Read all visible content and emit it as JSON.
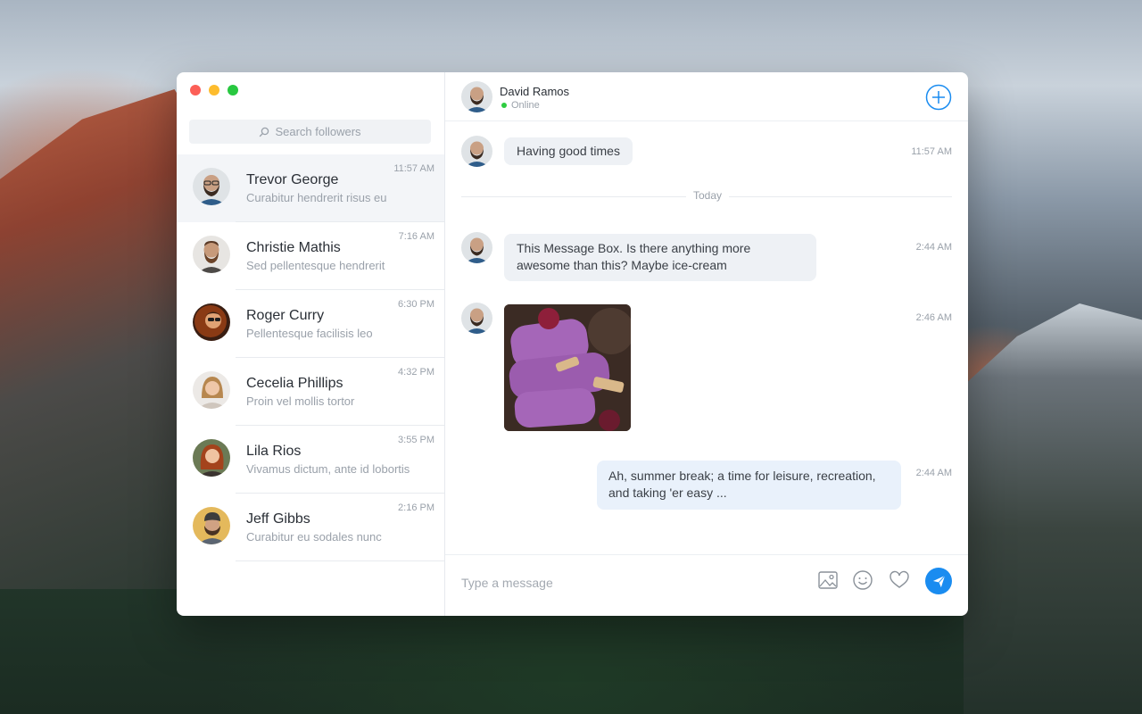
{
  "window": {
    "traffic_colors": [
      "#fc5f57",
      "#fdbc2e",
      "#28c840"
    ]
  },
  "sidebar": {
    "search_placeholder": "Search followers",
    "contacts": [
      {
        "name": "Trevor George",
        "preview": "Curabitur hendrerit risus eu",
        "time": "11:57 AM",
        "active": true
      },
      {
        "name": "Christie Mathis",
        "preview": "Sed pellentesque hendrerit",
        "time": "7:16 AM"
      },
      {
        "name": "Roger Curry",
        "preview": "Pellentesque facilisis leo",
        "time": "6:30 PM"
      },
      {
        "name": "Cecelia Phillips",
        "preview": "Proin vel mollis tortor",
        "time": "4:32 PM"
      },
      {
        "name": "Lila Rios",
        "preview": "Vivamus dictum, ante id lobortis",
        "time": "3:55 PM"
      },
      {
        "name": "Jeff Gibbs",
        "preview": "Curabitur eu sodales nunc",
        "time": "2:16 PM"
      }
    ]
  },
  "chat": {
    "header": {
      "name": "David Ramos",
      "status": "Online"
    },
    "divider_label": "Today",
    "messages": [
      {
        "text": "Having good times",
        "time": "11:57 AM"
      },
      {
        "text": "This Message Box. Is there anything more awesome than this? Maybe ice-cream",
        "time": "2:44 AM"
      },
      {
        "image": "ice-cream-photo",
        "time": "2:46 AM"
      },
      {
        "text": "Ah, summer break; a time for leisure, recreation, and taking 'er easy ...",
        "time": "2:44 AM"
      }
    ],
    "composer_placeholder": "Type a message"
  },
  "colors": {
    "accent": "#1a8cf0",
    "online": "#2ecc40"
  }
}
